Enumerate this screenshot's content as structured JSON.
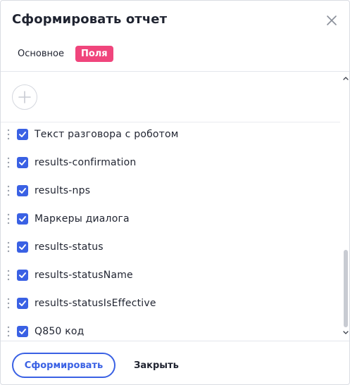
{
  "dialog": {
    "title": "Сформировать отчет",
    "close_icon": "close-icon"
  },
  "tabs": [
    {
      "label": "Основное",
      "active": false
    },
    {
      "label": "Поля",
      "active": true
    }
  ],
  "fields": {
    "add_icon": "plus-circle-icon",
    "items": [
      {
        "label": "Текст разговора с роботом",
        "checked": true
      },
      {
        "label": "results-confirmation",
        "checked": true
      },
      {
        "label": "results-nps",
        "checked": true
      },
      {
        "label": "Маркеры диалога",
        "checked": true
      },
      {
        "label": "results-status",
        "checked": true
      },
      {
        "label": "results-statusName",
        "checked": true
      },
      {
        "label": "results-statusIsEffective",
        "checked": true
      },
      {
        "label": "Q850 код",
        "checked": true
      }
    ]
  },
  "footer": {
    "submit_label": "Сформировать",
    "close_label": "Закрыть"
  },
  "colors": {
    "accent": "#3a61e4",
    "tab_active": "#f0457c",
    "text": "#1f2330"
  }
}
